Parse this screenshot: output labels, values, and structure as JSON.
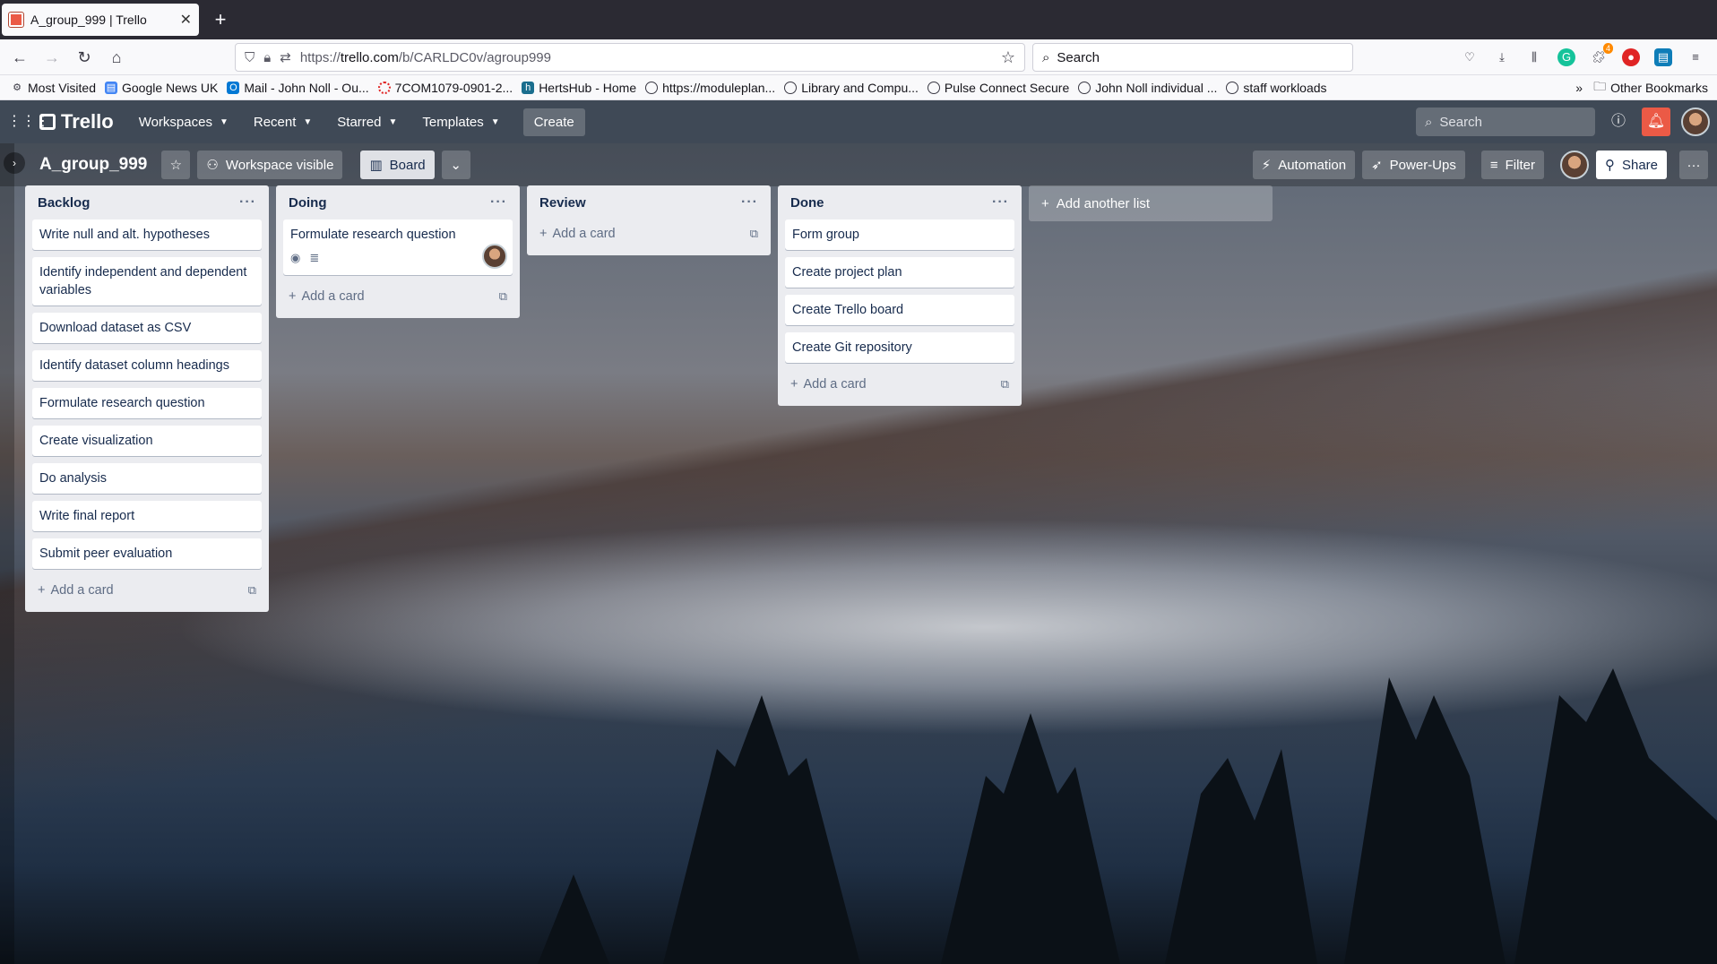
{
  "browser": {
    "tab_title": "A_group_999 | Trello",
    "url_prefix": "https://",
    "url_host": "trello.com",
    "url_path": "/b/CARLDC0v/agroup999",
    "search_placeholder": "Search",
    "ext_badge": "4"
  },
  "bookmarks": {
    "items": [
      {
        "label": "Most Visited",
        "icon": "gear-icon"
      },
      {
        "label": "Google News UK",
        "icon": "news-icon"
      },
      {
        "label": "Mail - John Noll - Ou...",
        "icon": "outlook-icon"
      },
      {
        "label": "7COM1079-0901-2...",
        "icon": "lifebuoy-icon"
      },
      {
        "label": "HertsHub - Home",
        "icon": "hertshub-icon"
      },
      {
        "label": "https://moduleplan...",
        "icon": "globe-icon"
      },
      {
        "label": "Library and Compu...",
        "icon": "globe-icon"
      },
      {
        "label": "Pulse Connect Secure",
        "icon": "globe-icon"
      },
      {
        "label": "John Noll individual ...",
        "icon": "globe-icon"
      },
      {
        "label": "staff workloads",
        "icon": "globe-icon"
      }
    ],
    "overflow": "»",
    "other": "Other Bookmarks"
  },
  "trello_header": {
    "logo": "Trello",
    "menus": [
      "Workspaces",
      "Recent",
      "Starred",
      "Templates"
    ],
    "create": "Create",
    "search_placeholder": "Search"
  },
  "board": {
    "title": "A_group_999",
    "visibility": "Workspace visible",
    "view": "Board",
    "automation": "Automation",
    "powerups": "Power-Ups",
    "filter": "Filter",
    "share": "Share",
    "add_list": "Add another list"
  },
  "lists": [
    {
      "name": "Backlog",
      "add": "Add a card",
      "cards": [
        "Write null and alt. hypotheses",
        "Identify independent and dependent variables",
        "Download dataset as CSV",
        "Identify dataset column headings",
        "Formulate research question",
        "Create visualization",
        "Do analysis",
        "Write final report",
        "Submit peer evaluation"
      ]
    },
    {
      "name": "Doing",
      "add": "Add a card",
      "cards": [
        "Formulate research question"
      ]
    },
    {
      "name": "Review",
      "add": "Add a card",
      "cards": []
    },
    {
      "name": "Done",
      "add": "Add a card",
      "cards": [
        "Form group",
        "Create project plan",
        "Create Trello board",
        "Create Git repository"
      ]
    }
  ]
}
